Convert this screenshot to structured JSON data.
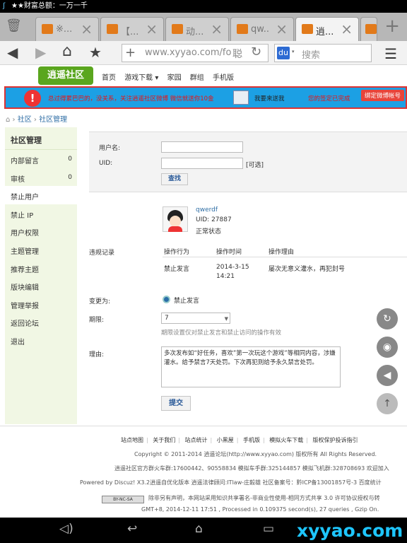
{
  "statusbar": {
    "text": "★★财富总额：一万一千"
  },
  "tabs": [
    {
      "title": "※..."
    },
    {
      "title": "【..."
    },
    {
      "title": "动..."
    },
    {
      "title": "qw..."
    },
    {
      "title": "逍..."
    }
  ],
  "addressbar": {
    "url": "www.xyyao.com/for",
    "reader": "聪",
    "search_placeholder": "搜索"
  },
  "site": {
    "logo": "逍遥社区",
    "nav": [
      "首页",
      "游戏下载 ▾",
      "家园",
      "群组",
      "手机版"
    ]
  },
  "banner": {
    "text": "总过得累巴巴的，没关系，关注逍遥社区微博 微信就送你10金",
    "text2": "我要来送我",
    "text3": "您的签定已完成",
    "weibo": "绑定微博帐号"
  },
  "breadcrumb": {
    "home": "⌂",
    "a": "社区",
    "b": "社区管理"
  },
  "sidebar": {
    "title": "社区管理",
    "items": [
      {
        "label": "内部留言",
        "count": "0"
      },
      {
        "label": "审核",
        "count": "0"
      },
      {
        "label": "禁止用户",
        "count": ""
      },
      {
        "label": "禁止 IP",
        "count": ""
      },
      {
        "label": "用户权限",
        "count": ""
      },
      {
        "label": "主题管理",
        "count": ""
      },
      {
        "label": "推荐主题",
        "count": ""
      },
      {
        "label": "版块编辑",
        "count": ""
      },
      {
        "label": "管理举报",
        "count": ""
      },
      {
        "label": "返回论坛",
        "count": ""
      },
      {
        "label": "退出",
        "count": ""
      }
    ]
  },
  "form": {
    "username_label": "用户名:",
    "uid_label": "UID:",
    "optional": "[可选]",
    "find_button": "查找"
  },
  "user": {
    "name": "qwerdf",
    "uid": "UID: 27887",
    "status": "正常状态"
  },
  "records": {
    "label": "违规记录",
    "headers": [
      "操作行为",
      "操作时间",
      "操作理由"
    ],
    "rows": [
      {
        "action": "禁止发言",
        "time1": "2014-3-15",
        "time2": "14:21",
        "reason": "屡次无意义灌水，再犯封号"
      }
    ]
  },
  "change": {
    "label": "变更为:",
    "option": "禁止发言"
  },
  "period": {
    "label": "期限:",
    "value": "7",
    "hint": "期限设置仅对禁止发言和禁止访问的操作有效"
  },
  "reason": {
    "label": "理由:",
    "text": "多次发布如“好任务，喜欢”第一次玩这个游戏”等相同内容，涉嫌灌水。给予禁言7天处罚。下次再犯则给予永久禁言处罚。"
  },
  "submit": "提交",
  "footer": {
    "links": [
      "站点地图",
      "关于我们",
      "站点统计",
      "小黑屋",
      "手机版",
      "模拟火车下载",
      "版权保护投诉指引"
    ],
    "copyright": "Copyright © 2011-2014 逍遥论坛(http://www.xyyao.com) 版权所有 All Rights Reserved.",
    "groups": "逍遥社区官方群火车群:17600442、90558834 模拟车手群:325144857 模拟飞机群:328708693 欢迎加入",
    "powered": "Powered by Discuz! X3.2逍遥自优化版本   逍遥法律顾问:ITlaw-庄毅雄 社区备案号：黔ICP备13001857号-3   百度统计",
    "license_badge": "BY-NC-SA",
    "license": "除非另有声明，本网站采用知识共享署名-非商业性使用-相同方式共享 3.0 许可协议授权与转",
    "stats": "GMT+8, 2014-12-11 17:51 , Processed in 0.109375 second(s), 27 queries , Gzip On."
  },
  "watermark": "xyyao.com"
}
